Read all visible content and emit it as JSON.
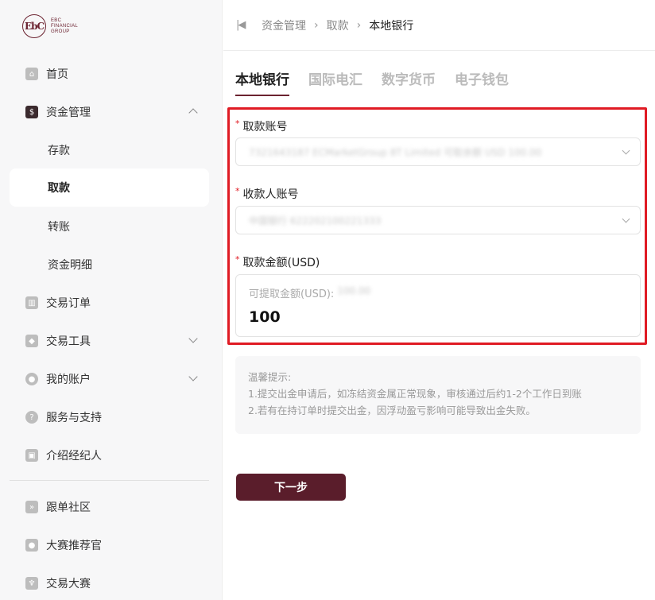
{
  "logo": {
    "mark": "EbC",
    "line1": "EBC",
    "line2": "FINANCIAL",
    "line3": "GROUP"
  },
  "sidebar": {
    "home": "首页",
    "funds": "资金管理",
    "funds_sub": [
      "存款",
      "取款",
      "转账",
      "资金明细"
    ],
    "orders": "交易订单",
    "tools": "交易工具",
    "account": "我的账户",
    "support": "服务与支持",
    "ib": "介绍经纪人",
    "copy": "跟单社区",
    "contest_rec": "大赛推荐官",
    "contest": "交易大赛"
  },
  "breadcrumb": [
    "资金管理",
    "取款",
    "本地银行"
  ],
  "tabs": [
    "本地银行",
    "国际电汇",
    "数字货币",
    "电子钱包"
  ],
  "form": {
    "withdraw_account_label": "取款账号",
    "withdraw_account_value": "7321643187 ECMarketGroup 8T Limited     可取余额 USD 100.00",
    "payee_account_label": "收款人账号",
    "payee_account_value": "中国银行 622202100221333",
    "amount_label": "取款金额(USD)",
    "available_label": "可提取金额(USD):",
    "available_value": "100.00",
    "amount_value": "100"
  },
  "tips": {
    "title": "温馨提示:",
    "line1": "1.提交出金申请后，如冻结资金属正常现象，审核通过后约1-2个工作日到账",
    "line2": "2.若有在持订单时提交出金，因浮动盈亏影响可能导致出金失败。"
  },
  "next_button": "下一步",
  "colors": {
    "brand": "#5a1d2b",
    "highlight": "#e01b24"
  }
}
